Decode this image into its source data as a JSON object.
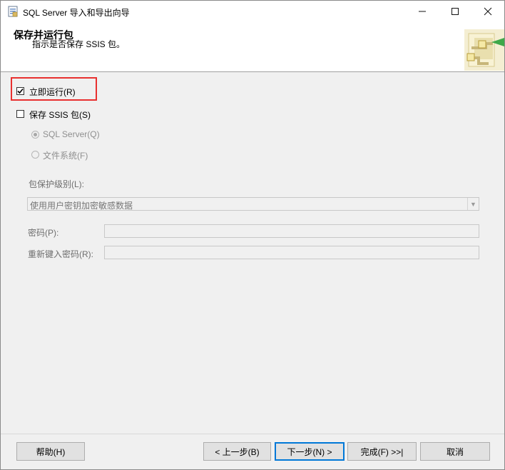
{
  "window": {
    "title": "SQL Server 导入和导出向导",
    "controls": {
      "minimize": "—",
      "maximize": "☐",
      "close": "✕"
    }
  },
  "header": {
    "title": "保存并运行包",
    "subtitle": "指示是否保存 SSIS 包。"
  },
  "options": {
    "run_immediately": {
      "label": "立即运行(R)",
      "checked": true
    },
    "save_ssis": {
      "label": "保存 SSIS 包(S)",
      "checked": false
    },
    "sql_server": {
      "label": "SQL Server(Q)",
      "selected": true,
      "enabled": false
    },
    "file_system": {
      "label": "文件系统(F)",
      "selected": false,
      "enabled": false
    }
  },
  "protection": {
    "label": "包保护级别(L):",
    "selected": "使用用户密钥加密敏感数据"
  },
  "password": {
    "label": "密码(P):",
    "value": ""
  },
  "retype_password": {
    "label": "重新键入密码(R):",
    "value": ""
  },
  "footer": {
    "help": "帮助(H)",
    "back": "< 上一步(B)",
    "next": "下一步(N) >",
    "finish": "完成(F) >>|",
    "cancel": "取消"
  },
  "colors": {
    "highlight": "#e8302f",
    "default_button_border": "#0078d7"
  }
}
